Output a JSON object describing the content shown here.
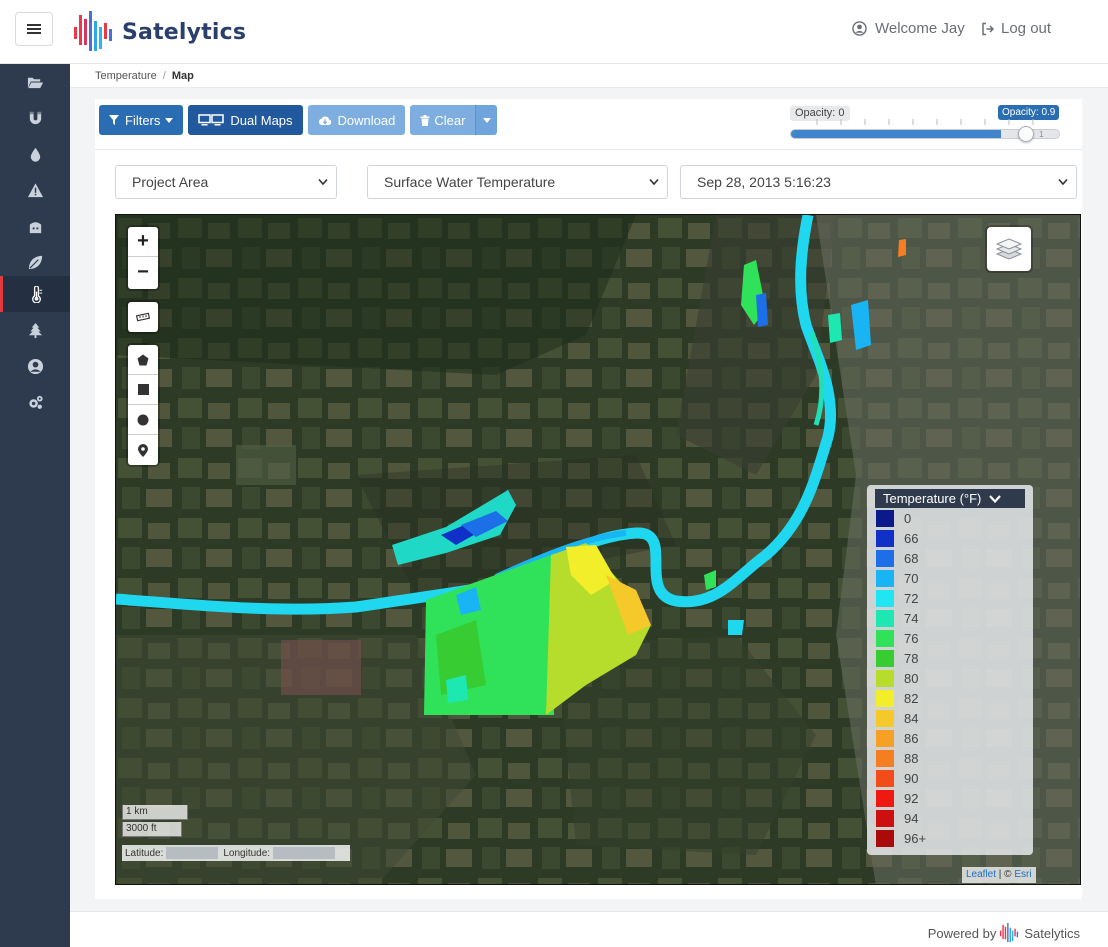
{
  "header": {
    "brand": "Satelytics",
    "welcome": "Welcome Jay",
    "logout": "Log out"
  },
  "sidebar": {
    "items": [
      {
        "icon": "folder-open-icon"
      },
      {
        "icon": "magnet-icon"
      },
      {
        "icon": "droplet-icon"
      },
      {
        "icon": "warning-icon"
      },
      {
        "icon": "oil-tank-icon"
      },
      {
        "icon": "leaf-icon"
      },
      {
        "icon": "thermometer-icon",
        "active": true
      },
      {
        "icon": "tree-icon"
      },
      {
        "icon": "user-circle-icon"
      },
      {
        "icon": "cogs-icon"
      }
    ]
  },
  "breadcrumb": {
    "parent": "Temperature",
    "separator": "/",
    "current": "Map"
  },
  "toolbar": {
    "filters": "Filters",
    "dual_maps": "Dual Maps",
    "download": "Download",
    "clear": "Clear"
  },
  "opacity": {
    "min_label": "Opacity: 0",
    "current_label": "Opacity: 0.9",
    "max_label": "1",
    "value": 0.9
  },
  "filters": {
    "area": "Project Area",
    "parameter": "Surface Water Temperature",
    "date": "Sep 28, 2013 5:16:23"
  },
  "map": {
    "zoom_in": "+",
    "zoom_out": "−",
    "scale_km": "1 km",
    "scale_ft": "3000 ft",
    "latitude_label": "Latitude:",
    "longitude_label": "Longitude:",
    "attribution_leaflet": "Leaflet",
    "attribution_sep": " | © ",
    "attribution_esri": "Esri"
  },
  "legend": {
    "title": "Temperature (°F)",
    "items": [
      {
        "label": "0",
        "color": "#0a1a8a"
      },
      {
        "label": "66",
        "color": "#1030c8"
      },
      {
        "label": "68",
        "color": "#1d6fe8"
      },
      {
        "label": "70",
        "color": "#18b4f4"
      },
      {
        "label": "72",
        "color": "#1fe6f2"
      },
      {
        "label": "74",
        "color": "#1de8b2"
      },
      {
        "label": "76",
        "color": "#2fe25a"
      },
      {
        "label": "78",
        "color": "#36cc32"
      },
      {
        "label": "80",
        "color": "#b6dc2c"
      },
      {
        "label": "82",
        "color": "#f2ef2a"
      },
      {
        "label": "84",
        "color": "#f6c92a"
      },
      {
        "label": "86",
        "color": "#f6a026"
      },
      {
        "label": "88",
        "color": "#f57e20"
      },
      {
        "label": "90",
        "color": "#f24d18"
      },
      {
        "label": "92",
        "color": "#ee1a12"
      },
      {
        "label": "94",
        "color": "#cc1010"
      },
      {
        "label": "96+",
        "color": "#aa0a0a"
      }
    ]
  },
  "footer": {
    "powered_by": "Powered by",
    "brand": "Satelytics"
  }
}
